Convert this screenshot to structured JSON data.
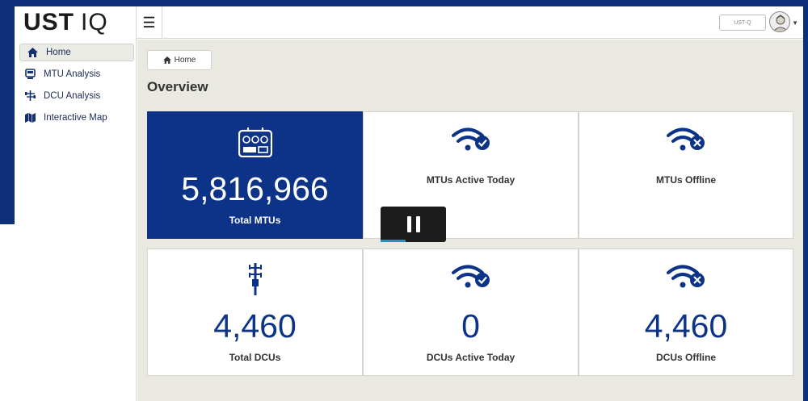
{
  "app": {
    "logo_left": "UST",
    "logo_right": "IQ"
  },
  "header": {
    "menu_icon": "hamburger-icon",
    "user_label": "UST-Q",
    "avatar_icon": "avatar-icon",
    "caret_icon": "caret-down-icon"
  },
  "sidebar": {
    "items": [
      {
        "label": "Home",
        "icon": "home-icon",
        "active": true
      },
      {
        "label": "MTU Analysis",
        "icon": "meter-icon",
        "active": false
      },
      {
        "label": "DCU Analysis",
        "icon": "network-icon",
        "active": false
      },
      {
        "label": "Interactive Map",
        "icon": "map-icon",
        "active": false
      }
    ]
  },
  "breadcrumb": {
    "label": "Home",
    "icon": "home-icon"
  },
  "page_title": "Overview",
  "cards": [
    {
      "value": "5,816,966",
      "label": "Total MTUs",
      "icon": "meter-device-icon",
      "highlight": true
    },
    {
      "value": "",
      "label": "MTUs Active Today",
      "icon": "wifi-check-icon",
      "highlight": false
    },
    {
      "value": "",
      "label": "MTUs Offline",
      "icon": "wifi-x-icon",
      "highlight": false
    },
    {
      "value": "4,460",
      "label": "Total DCUs",
      "icon": "tower-icon",
      "highlight": false
    },
    {
      "value": "0",
      "label": "DCUs Active Today",
      "icon": "wifi-check-icon",
      "highlight": false
    },
    {
      "value": "4,460",
      "label": "DCUs Offline",
      "icon": "wifi-x-icon",
      "highlight": false
    }
  ],
  "video_overlay": {
    "icon": "pause-icon",
    "progress": 0.38
  },
  "colors": {
    "brand": "#0c3388",
    "frame": "#0e2f7a",
    "background": "#e9e9e1"
  }
}
